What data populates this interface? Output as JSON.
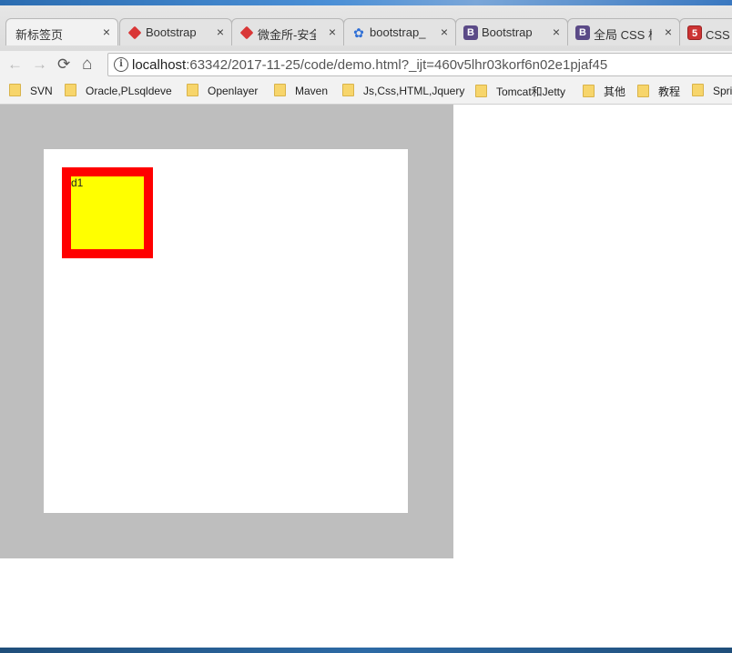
{
  "tabs": [
    {
      "label": "新标签页",
      "icon": "none",
      "active": true
    },
    {
      "label": "Bootstrap",
      "icon": "bootstrap-red-icon"
    },
    {
      "label": "微金所-安全",
      "icon": "weijinsuo-icon"
    },
    {
      "label": "bootstrap_",
      "icon": "baidu-paw-icon"
    },
    {
      "label": "Bootstrap",
      "icon": "bootstrap-b-icon"
    },
    {
      "label": "全局 CSS 样",
      "icon": "bootstrap-b-icon"
    },
    {
      "label": "CSS 编",
      "icon": "css-icon"
    }
  ],
  "tab_close": "×",
  "nav": {
    "back": "←",
    "forward": "→",
    "reload": "⟳",
    "home": "⌂"
  },
  "address": {
    "host": "localhost",
    "rest": ":63342/2017-11-25/code/demo.html?_ijt=460v5lhr03korf6n02e1pjaf45",
    "info": "i"
  },
  "bookmarks": [
    "SVN",
    "Oracle,PLsqldeve",
    "Openlayer",
    "Maven",
    "Js,Css,HTML,Jquery",
    "Tomcat和Jetty",
    "其他",
    "教程",
    "Spri"
  ],
  "page": {
    "d1_label": "d1"
  },
  "colors": {
    "outer": "#bebebe",
    "inner": "#ffffff",
    "d1_fill": "#ffff00",
    "d1_border": "#ff0000"
  }
}
